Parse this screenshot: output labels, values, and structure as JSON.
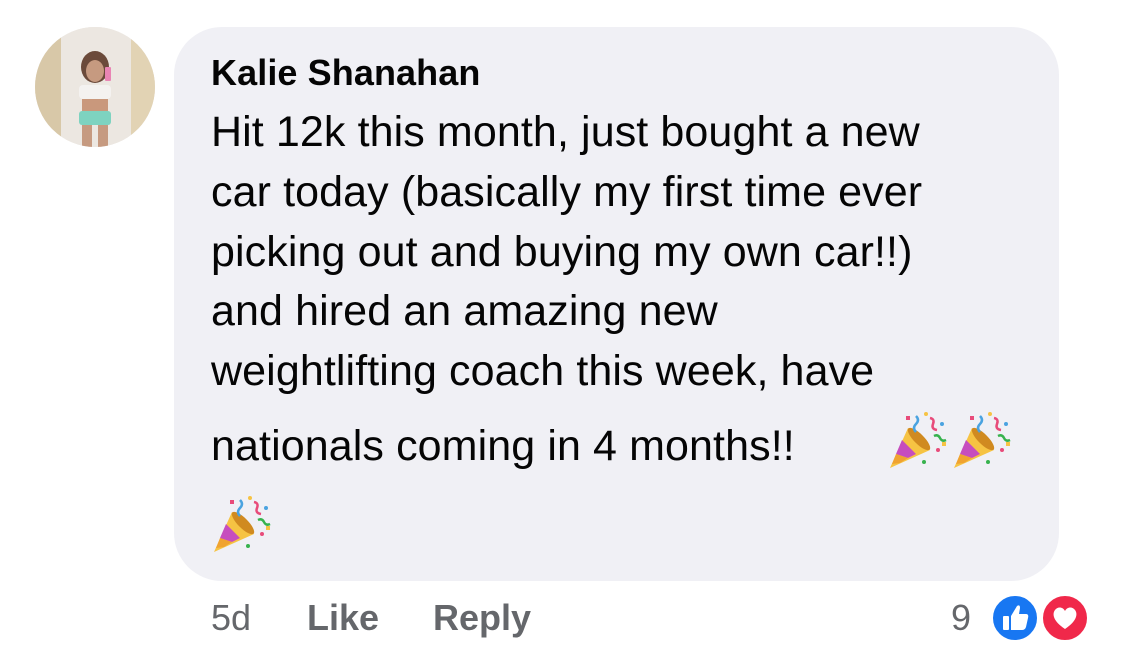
{
  "comment": {
    "author": "Kalie Shanahan",
    "text_lines": [
      "Hit 12k this month, just bought a new",
      "car today (basically my first time ever",
      "picking out and buying my own car!!)",
      "and hired an amazing new",
      "weightlifting coach this week, have",
      "nationals coming in 4 months!!"
    ],
    "emoji": [
      "party-popper",
      "party-popper",
      "party-popper"
    ]
  },
  "actions": {
    "time": "5d",
    "like_label": "Like",
    "reply_label": "Reply"
  },
  "reactions": {
    "count": "9",
    "types": [
      "like-icon",
      "love-icon"
    ]
  },
  "colors": {
    "bubble": "#f0f0f5",
    "text": "#050505",
    "meta": "#65676b",
    "like": "#1877f2",
    "love": "#f0284a"
  }
}
